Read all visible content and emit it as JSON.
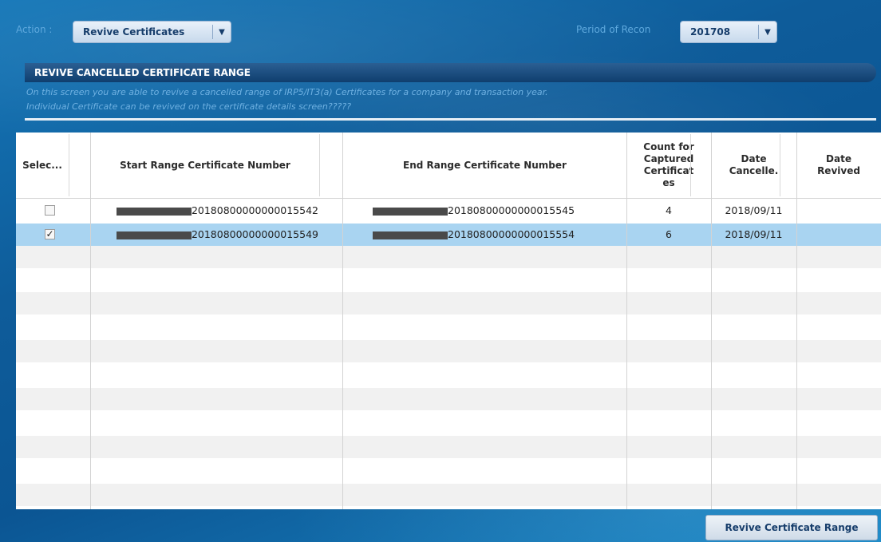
{
  "top_bar": {
    "action_label": "Action :",
    "action_value": "Revive Certificates",
    "period_label": "Period of Recon",
    "period_value": "201708"
  },
  "section": {
    "title": "REVIVE CANCELLED CERTIFICATE RANGE",
    "description_line1": "On this screen you are able to revive a cancelled range of IRP5/IT3(a) Certificates for a company and transaction year.",
    "description_line2": "Individual Certificate can be revived on the certificate details screen?????"
  },
  "table": {
    "headers": {
      "select": "Selec...",
      "start": "Start Range Certificate Number",
      "end": "End Range Certificate Number",
      "count_l1": "Count for",
      "count_l2": "Captured",
      "count_l3": "Certificat",
      "count_l4": "es",
      "cancelled_l1": "Date",
      "cancelled_l2": "Cancelle.",
      "revived_l1": "Date",
      "revived_l2": "Revived"
    },
    "rows": [
      {
        "checked": false,
        "start": "20180800000000015542",
        "end": "20180800000000015545",
        "count": "4",
        "date_cancelled": "2018/09/11",
        "date_revived": ""
      },
      {
        "checked": true,
        "start": "20180800000000015549",
        "end": "20180800000000015554",
        "count": "6",
        "date_cancelled": "2018/09/11",
        "date_revived": ""
      }
    ]
  },
  "buttons": {
    "revive_range": "Revive Certificate Range"
  },
  "icons": {
    "dropdown_arrow": "chevron-down-icon",
    "checkbox_checked": "checkmark-icon"
  }
}
